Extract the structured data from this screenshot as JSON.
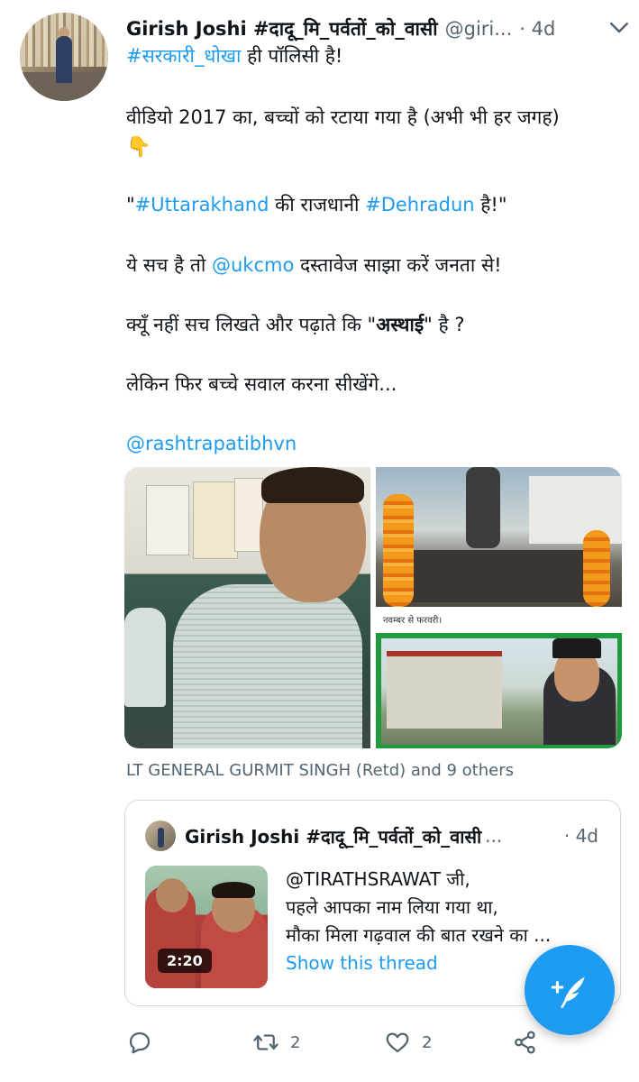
{
  "tweet": {
    "author_name": "Girish Joshi #दादू_मि_पर्वतों_को_वासी",
    "author_handle": "@giri...",
    "time": "· 4d",
    "lines": {
      "l1_tag": "#सरकारी_धोखा",
      "l1_rest": " ही पॉलिसी है!",
      "l2": "वीडियो 2017 का, बच्चों को रटाया गया है (अभी भी हर जगह)",
      "l3_emoji": "👇",
      "l4_q1": "\"",
      "l4_tag1": "#Uttarakhand",
      "l4_mid": " की राजधानी ",
      "l4_tag2": "#Dehradun",
      "l4_end": " है!\"",
      "l5_a": "ये सच है तो ",
      "l5_mention": "@ukcmo",
      "l5_b": " दस्तावेज साझा करें जनता से!",
      "l6_a": "क्यूँ नहीं सच लिखते और पढ़ाते कि \"",
      "l6_bold": "अस्थाई",
      "l6_b": "\" है ?",
      "l7": "लेकिन फिर बच्चे सवाल करना सीखेंगे...",
      "l8_mention": "@rashtrapatibhvn"
    },
    "media_caption": "नवम्बर से फरवरी।",
    "tagged": "LT GENERAL GURMIT SINGH (Retd) and 9 others"
  },
  "quoted": {
    "author_name": "Girish Joshi #दादू_मि_पर्वतों_को_वासी",
    "ellipsis": "...",
    "time": "· 4d",
    "video_duration": "2:20",
    "text_lines": [
      "@TIRATHSRAWAT जी,",
      "पहले आपका नाम लिया गया था,",
      "मौका मिला गढ़वाल की बात रखने का ..."
    ],
    "show_thread": "Show this thread"
  },
  "actions": {
    "reply_icon": "reply-icon",
    "retweet_count": "2",
    "like_count": "2",
    "share_icon": "share-icon"
  },
  "colors": {
    "accent": "#1d9bf0",
    "text": "#0f1419",
    "muted": "#536471",
    "border": "#cfd9de"
  }
}
